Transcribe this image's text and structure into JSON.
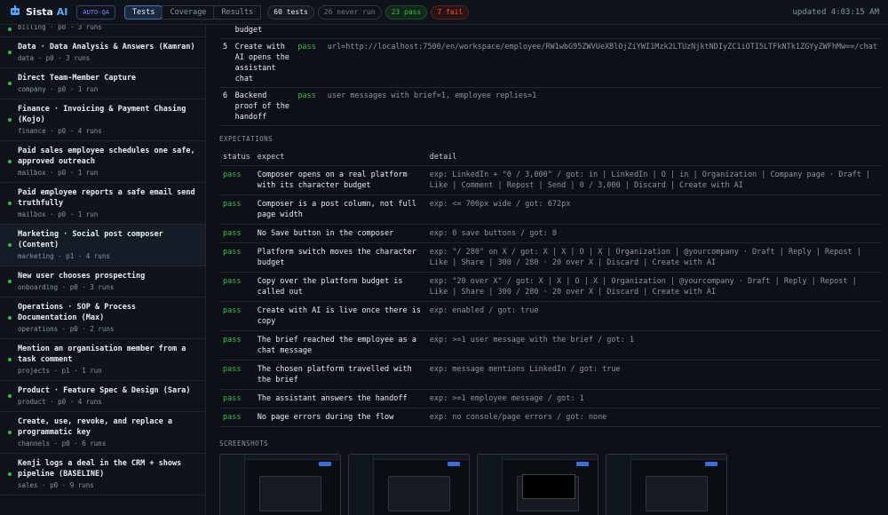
{
  "header": {
    "brand": "Sista",
    "brand_ai": "AI",
    "mode": "AUTO-QA",
    "tabs": [
      "Tests",
      "Coverage",
      "Results"
    ],
    "counts": {
      "all": "60 tests",
      "never": "26 never run",
      "pass": "23 pass",
      "fail": "7 fail"
    },
    "updated": "updated 4:03:15 AM"
  },
  "sidebar": {
    "items": [
      {
        "title": "",
        "meta": "billing · p0 · 3 runs"
      },
      {
        "title": "Data · Data Analysis & Answers (Kamran)",
        "meta": "data · p0 · 3 runs"
      },
      {
        "title": "Direct Team-Member Capture",
        "meta": "company · p0 · 1 run"
      },
      {
        "title": "Finance · Invoicing & Payment Chasing (Kojo)",
        "meta": "finance · p0 · 4 runs"
      },
      {
        "title": "Paid sales employee schedules one safe, approved outreach",
        "meta": "mailbox · p0 · 1 run"
      },
      {
        "title": "Paid employee reports a safe email send truthfully",
        "meta": "mailbox · p0 · 1 run"
      },
      {
        "title": "Marketing · Social post composer (Content)",
        "meta": "marketing · p1 · 4 runs"
      },
      {
        "title": "New user chooses prospecting",
        "meta": "onboarding · p0 · 3 runs"
      },
      {
        "title": "Operations · SOP & Process Documentation (Max)",
        "meta": "operations · p0 · 2 runs"
      },
      {
        "title": "Mention an organisation member from a task comment",
        "meta": "projects · p1 · 1 run"
      },
      {
        "title": "Product · Feature Spec & Design (Sara)",
        "meta": "product · p0 · 4 runs"
      },
      {
        "title": "Create, use, revoke, and replace a programmatic key",
        "meta": "channels · p0 · 6 runs"
      },
      {
        "title": "Kenji logs a deal in the CRM + shows pipeline (BASELINE)",
        "meta": "sales · p0 · 9 runs"
      }
    ]
  },
  "steps": [
    {
      "num": "",
      "name": "budget",
      "status": "",
      "result": ""
    },
    {
      "num": "5",
      "name": "Create with AI opens the assistant chat",
      "status": "pass",
      "result": "url=http://localhost:7500/en/workspace/employee/RW1wbG95ZWVUeXBlOjZiYWI1Mzk2LTUzNjktNDIyZC1iOTI5LTFkNTk1ZGYyZWFhMw==/chat"
    },
    {
      "num": "6",
      "name": "Backend proof of the handoff",
      "status": "pass",
      "result": "user messages with brief=1, employee replies=1"
    }
  ],
  "expectations": {
    "section": "EXPECTATIONS",
    "headers": {
      "status": "status",
      "expect": "expect",
      "detail": "detail"
    },
    "rows": [
      {
        "status": "pass",
        "expect": "Composer opens on a real platform with its character budget",
        "detail": "exp: LinkedIn + \"0 / 3,000\" / got: in | LinkedIn | O | in | Organization | Company page · Draft | Like | Comment | Repost | Send | 0 / 3,000 | Discard | Create with AI"
      },
      {
        "status": "pass",
        "expect": "Composer is a post column, not full page width",
        "detail": "exp: <= 700px wide / got: 672px"
      },
      {
        "status": "pass",
        "expect": "No Save button in the composer",
        "detail": "exp: 0 save buttons / got: 0"
      },
      {
        "status": "pass",
        "expect": "Platform switch moves the character budget",
        "detail": "exp: \"/ 280\" on X / got: X | X | O | X | Organization | @yourcompany · Draft | Reply | Repost | Like | Share | 300 / 280 · 20 over X | Discard | Create with AI"
      },
      {
        "status": "pass",
        "expect": "Copy over the platform budget is called out",
        "detail": "exp: \"20 over X\" / got: X | X | O | X | Organization | @yourcompany · Draft | Reply | Repost | Like | Share | 300 / 280 · 20 over X | Discard | Create with AI"
      },
      {
        "status": "pass",
        "expect": "Create with AI is live once there is copy",
        "detail": "exp: enabled / got: true"
      },
      {
        "status": "pass",
        "expect": "The brief reached the employee as a chat message",
        "detail": "exp: >=1 user message with the brief / got: 1"
      },
      {
        "status": "pass",
        "expect": "The chosen platform travelled with the brief",
        "detail": "exp: message mentions LinkedIn / got: true"
      },
      {
        "status": "pass",
        "expect": "The assistant answers the handoff",
        "detail": "exp: >=1 employee message / got: 1"
      },
      {
        "status": "pass",
        "expect": "No page errors during the flow",
        "detail": "exp: no console/page errors / got: none"
      }
    ]
  },
  "screenshots": {
    "section": "SCREENSHOTS"
  },
  "colors": {
    "accent": "#58a6ff",
    "pass": "#3fb950",
    "fail": "#f85149",
    "bg": "#0d1117"
  }
}
